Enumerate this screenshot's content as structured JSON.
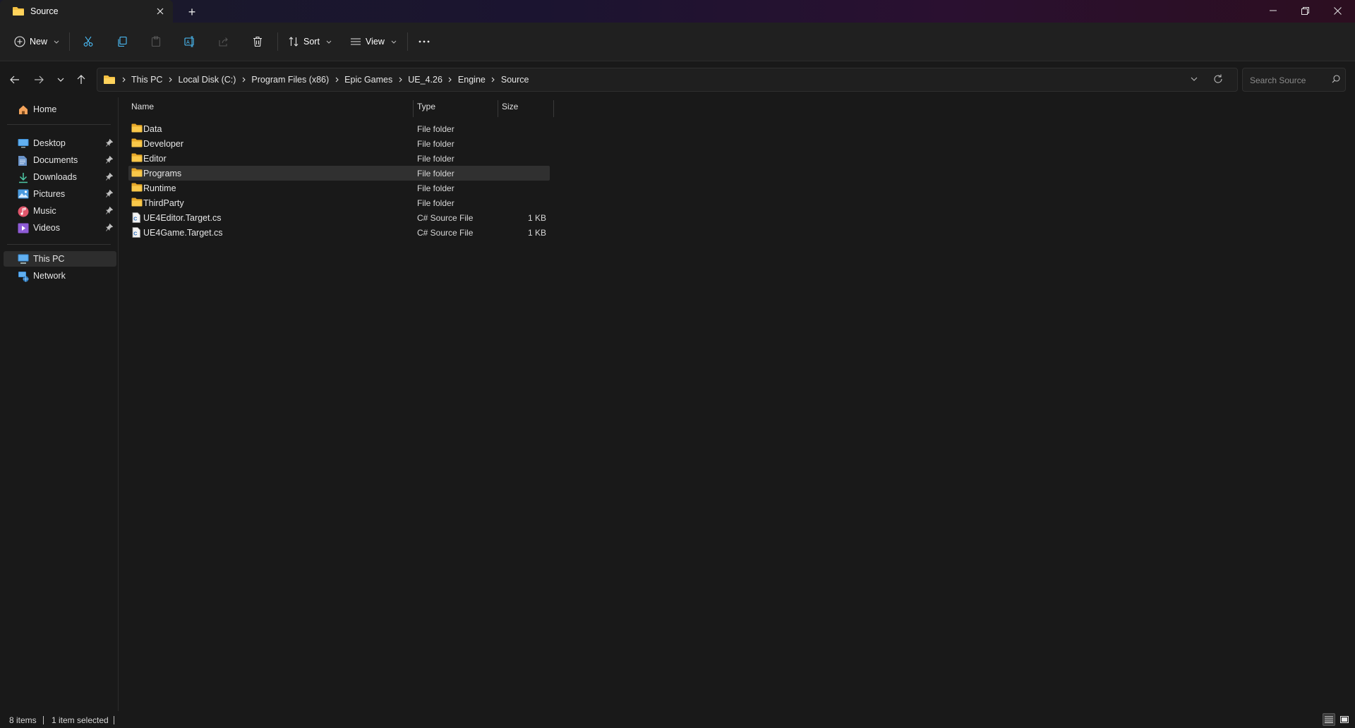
{
  "window": {
    "tab_title": "Source",
    "new_tab_symbol": "+"
  },
  "toolbar": {
    "new_label": "New",
    "sort_label": "Sort",
    "view_label": "View",
    "icons": [
      "plus-circle-icon",
      "cut-icon",
      "copy-icon",
      "paste-icon",
      "rename-icon",
      "share-icon",
      "delete-icon",
      "sort-icon",
      "view-icon",
      "more-icon"
    ]
  },
  "address": {
    "breadcrumbs": [
      "This PC",
      "Local Disk (C:)",
      "Program Files (x86)",
      "Epic Games",
      "UE_4.26",
      "Engine",
      "Source"
    ]
  },
  "search": {
    "placeholder": "Search Source"
  },
  "sidebar": {
    "home": "Home",
    "quick_access": [
      {
        "label": "Desktop",
        "icon": "desktop-icon",
        "pinned": true
      },
      {
        "label": "Documents",
        "icon": "documents-icon",
        "pinned": true
      },
      {
        "label": "Downloads",
        "icon": "downloads-icon",
        "pinned": true
      },
      {
        "label": "Pictures",
        "icon": "pictures-icon",
        "pinned": true
      },
      {
        "label": "Music",
        "icon": "music-icon",
        "pinned": true
      },
      {
        "label": "Videos",
        "icon": "videos-icon",
        "pinned": true
      }
    ],
    "this_pc": "This PC",
    "network": "Network",
    "selected": "This PC"
  },
  "columns": {
    "name": "Name",
    "type": "Type",
    "size": "Size"
  },
  "files": [
    {
      "name": "Data",
      "type": "File folder",
      "size": "",
      "kind": "folder"
    },
    {
      "name": "Developer",
      "type": "File folder",
      "size": "",
      "kind": "folder"
    },
    {
      "name": "Editor",
      "type": "File folder",
      "size": "",
      "kind": "folder"
    },
    {
      "name": "Programs",
      "type": "File folder",
      "size": "",
      "kind": "folder",
      "selected": true
    },
    {
      "name": "Runtime",
      "type": "File folder",
      "size": "",
      "kind": "folder"
    },
    {
      "name": "ThirdParty",
      "type": "File folder",
      "size": "",
      "kind": "folder"
    },
    {
      "name": "UE4Editor.Target.cs",
      "type": "C# Source File",
      "size": "1 KB",
      "kind": "file"
    },
    {
      "name": "UE4Game.Target.cs",
      "type": "C# Source File",
      "size": "1 KB",
      "kind": "file"
    }
  ],
  "status": {
    "items": "8 items",
    "selection": "1 item selected"
  },
  "colors": {
    "folder": "#f4c042",
    "accent": "#4cc2ff",
    "background": "#191919"
  }
}
